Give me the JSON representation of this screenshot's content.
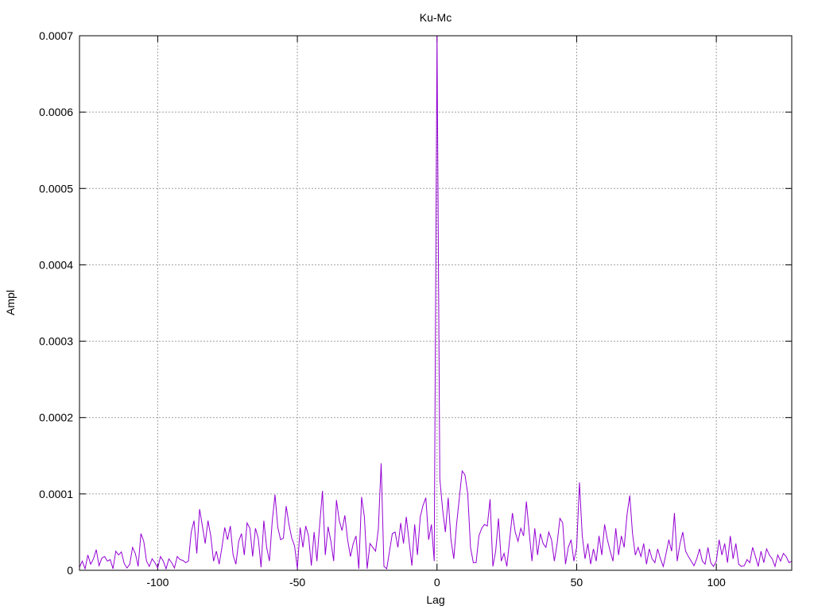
{
  "chart_data": {
    "type": "line",
    "title": "Ku-Mc",
    "xlabel": "Lag",
    "ylabel": "Ampl",
    "xlim": [
      -128,
      127
    ],
    "ylim": [
      0,
      0.0007
    ],
    "xticks": [
      -100,
      -50,
      0,
      50,
      100
    ],
    "yticks": [
      0,
      0.0001,
      0.0002,
      0.0003,
      0.0004,
      0.0005,
      0.0006,
      0.0007
    ],
    "xtick_labels": [
      "-100",
      "-50",
      "0",
      "50",
      "100"
    ],
    "ytick_labels": [
      "0",
      "0.0001",
      "0.0002",
      "0.0003",
      "0.0004",
      "0.0005",
      "0.0006",
      "0.0007"
    ],
    "grid": true,
    "line_color": "#9400d3",
    "series": [
      {
        "x": [
          -128,
          -127,
          -126,
          -125,
          -124,
          -123,
          -122,
          -121,
          -120,
          -119,
          -118,
          -117,
          -116,
          -115,
          -114,
          -113,
          -112,
          -111,
          -110,
          -109,
          -108,
          -107,
          -106,
          -105,
          -104,
          -103,
          -102,
          -101,
          -100,
          -99,
          -98,
          -97,
          -96,
          -95,
          -94,
          -93,
          -92,
          -91,
          -90,
          -89,
          -88,
          -87,
          -86,
          -85,
          -84,
          -83,
          -82,
          -81,
          -80,
          -79,
          -78,
          -77,
          -76,
          -75,
          -74,
          -73,
          -72,
          -71,
          -70,
          -69,
          -68,
          -67,
          -66,
          -65,
          -64,
          -63,
          -62,
          -61,
          -60,
          -59,
          -58,
          -57,
          -56,
          -55,
          -54,
          -53,
          -52,
          -51,
          -50,
          -49,
          -48,
          -47,
          -46,
          -45,
          -44,
          -43,
          -42,
          -41,
          -40,
          -39,
          -38,
          -37,
          -36,
          -35,
          -34,
          -33,
          -32,
          -31,
          -30,
          -29,
          -28,
          -27,
          -26,
          -25,
          -24,
          -23,
          -22,
          -21,
          -20,
          -19,
          -18,
          -17,
          -16,
          -15,
          -14,
          -13,
          -12,
          -11,
          -10,
          -9,
          -8,
          -7,
          -6,
          -5,
          -4,
          -3,
          -2,
          -1,
          0,
          1,
          2,
          3,
          4,
          5,
          6,
          7,
          8,
          9,
          10,
          11,
          12,
          13,
          14,
          15,
          16,
          17,
          18,
          19,
          20,
          21,
          22,
          23,
          24,
          25,
          26,
          27,
          28,
          29,
          30,
          31,
          32,
          33,
          34,
          35,
          36,
          37,
          38,
          39,
          40,
          41,
          42,
          43,
          44,
          45,
          46,
          47,
          48,
          49,
          50,
          51,
          52,
          53,
          54,
          55,
          56,
          57,
          58,
          59,
          60,
          61,
          62,
          63,
          64,
          65,
          66,
          67,
          68,
          69,
          70,
          71,
          72,
          73,
          74,
          75,
          76,
          77,
          78,
          79,
          80,
          81,
          82,
          83,
          84,
          85,
          86,
          87,
          88,
          89,
          90,
          91,
          92,
          93,
          94,
          95,
          96,
          97,
          98,
          99,
          100,
          101,
          102,
          103,
          104,
          105,
          106,
          107,
          108,
          109,
          110,
          111,
          112,
          113,
          114,
          115,
          116,
          117,
          118,
          119,
          120,
          121,
          122,
          123,
          124,
          125,
          126,
          127
        ],
        "y": [
          4e-06,
          1.2e-05,
          2e-06,
          2e-05,
          8e-06,
          1.5e-05,
          2.7e-05,
          6e-06,
          1.6e-05,
          1.8e-05,
          1.2e-05,
          1.4e-05,
          2e-06,
          2.5e-05,
          2e-05,
          2.4e-05,
          9e-06,
          3e-06,
          8e-06,
          3e-05,
          2.2e-05,
          5e-06,
          4.8e-05,
          3.8e-05,
          1.2e-05,
          5e-06,
          1.5e-05,
          1e-05,
          3e-06,
          1.8e-05,
          1.2e-05,
          2e-06,
          1.5e-05,
          1e-05,
          3e-06,
          1.8e-05,
          1.4e-05,
          1.3e-05,
          1e-05,
          1.2e-05,
          5e-05,
          6.5e-05,
          2.2e-05,
          8e-05,
          5.8e-05,
          3.5e-05,
          6.5e-05,
          4.5e-05,
          1.2e-05,
          2.5e-05,
          8e-06,
          3e-05,
          5.6e-05,
          4e-05,
          5.8e-05,
          2e-05,
          8e-06,
          3.8e-05,
          4.8e-05,
          2e-05,
          6.2e-05,
          5.5e-05,
          1.8e-05,
          5.5e-05,
          4.2e-05,
          4e-06,
          6.5e-05,
          3e-05,
          1.2e-05,
          6.4e-05,
          9.9e-05,
          5.6e-05,
          4e-05,
          4.2e-05,
          8.4e-05,
          6e-05,
          4.2e-05,
          3.2e-05,
          2e-06,
          5.6e-05,
          3e-05,
          5.8e-05,
          4.5e-05,
          6e-06,
          5e-05,
          1.2e-05,
          6e-05,
          0.000104,
          2e-05,
          5.7e-05,
          3.8e-05,
          1.2e-05,
          9.2e-05,
          6.5e-05,
          5.2e-05,
          7.2e-05,
          4e-05,
          1.8e-05,
          3.5e-05,
          4.5e-05,
          2e-06,
          9.6e-05,
          7e-05,
          2e-06,
          3.5e-05,
          3e-05,
          2.5e-05,
          5.4e-05,
          0.00014,
          5e-06,
          2e-06,
          2.5e-05,
          4.8e-05,
          5e-05,
          3e-05,
          6.2e-05,
          3.5e-05,
          7e-05,
          3.8e-05,
          6e-06,
          6e-05,
          2e-05,
          7e-05,
          8.5e-05,
          9.5e-05,
          4e-05,
          6e-05,
          1.2e-05,
          0.0007,
          0.00012,
          8e-05,
          5e-05,
          9.5e-05,
          4e-05,
          1.5e-05,
          6e-05,
          9.5e-05,
          0.00013,
          0.000125,
          0.0001,
          3e-05,
          1e-05,
          1e-05,
          4.5e-05,
          5.5e-05,
          6e-05,
          5.8e-05,
          9.3e-05,
          5e-06,
          2.5e-05,
          6.8e-05,
          1.2e-05,
          2.2e-05,
          5e-06,
          4e-05,
          7.5e-05,
          5e-05,
          3.8e-05,
          5.5e-05,
          4.5e-05,
          9e-05,
          5e-05,
          1.2e-05,
          5.5e-05,
          2e-05,
          4.8e-05,
          3.5e-05,
          3e-05,
          5e-05,
          4e-05,
          1.2e-05,
          3.5e-05,
          6.8e-05,
          6.2e-05,
          8e-06,
          3e-05,
          4e-05,
          1.2e-05,
          3e-05,
          0.000115,
          4.5e-05,
          1.5e-05,
          3.5e-05,
          8e-06,
          2.8e-05,
          1.2e-05,
          4.5e-05,
          2e-05,
          6e-05,
          4e-05,
          2.5e-05,
          1.2e-05,
          5.5e-05,
          2e-05,
          4.5e-05,
          3e-05,
          7.2e-05,
          9.8e-05,
          4.8e-05,
          2e-05,
          3e-05,
          1.8e-05,
          3.5e-05,
          8e-06,
          2.8e-05,
          1.5e-05,
          1e-05,
          2.8e-05,
          1.5e-05,
          5e-06,
          2.2e-05,
          4e-05,
          2.5e-05,
          7.5e-05,
          1.2e-05,
          3.5e-05,
          5e-05,
          2.5e-05,
          1.8e-05,
          1.2e-05,
          6e-06,
          1.5e-05,
          2.8e-05,
          1.2e-05,
          8e-06,
          3e-05,
          1e-05,
          5e-06,
          1.2e-05,
          4e-05,
          2e-05,
          3.5e-05,
          1e-05,
          4.5e-05,
          1.5e-05,
          3.5e-05,
          8e-06,
          5e-06,
          6e-06,
          1.4e-05,
          1e-05,
          3e-05,
          1.8e-05,
          5e-06,
          2.5e-05,
          1e-05,
          2.8e-05,
          2e-05,
          1.5e-05,
          5e-06,
          2e-05,
          1.2e-05,
          2.2e-05,
          1.8e-05,
          1e-05,
          1.2e-05
        ]
      }
    ]
  }
}
